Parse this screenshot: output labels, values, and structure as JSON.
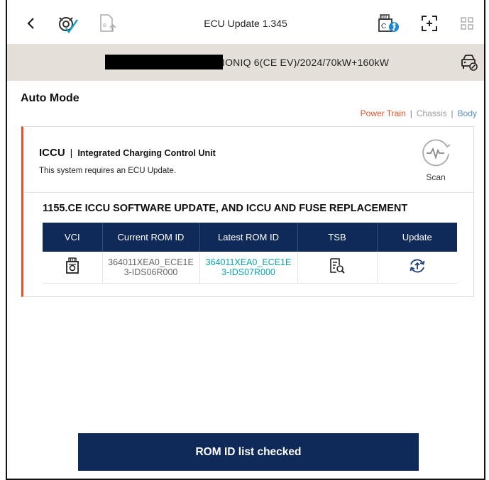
{
  "app": {
    "title": "ECU Update 1.345"
  },
  "vehicle": {
    "description": "IONIQ 6(CE EV)/2024/70kW+160kW"
  },
  "mode": {
    "title": "Auto Mode"
  },
  "categories": [
    {
      "label": "Power Train",
      "color": "#e2502d",
      "active": true
    },
    {
      "label": "Chassis",
      "color": "#9a9a9a",
      "active": false
    },
    {
      "label": "Body",
      "color": "#5a93c8",
      "active": false
    }
  ],
  "system": {
    "code": "ICCU",
    "divider": "|",
    "name": "Integrated Charging Control Unit",
    "message": "This system requires an ECU Update.",
    "scan_label": "Scan"
  },
  "update": {
    "title": "1155.CE ICCU SOFTWARE UPDATE, AND ICCU AND FUSE REPLACEMENT",
    "columns": [
      "VCI",
      "Current ROM ID",
      "Latest ROM ID",
      "TSB",
      "Update"
    ],
    "row": {
      "current_rom_line1": "364011XEA0_ECE1E",
      "current_rom_line2": "3-IDS06R000",
      "latest_rom_line1": "364011XEA0_ECE1E",
      "latest_rom_line2": "3-IDS07R000"
    }
  },
  "actions": {
    "primary_label": "ROM ID list checked"
  },
  "colors": {
    "accent_navy": "#0f2a58",
    "alert_red": "#e2502d",
    "teal": "#0aa3b3",
    "vehicle_bar": "#e4dfd9"
  },
  "icons": [
    "back-arrow-icon",
    "vci-check-icon",
    "export-doc-icon",
    "bluetooth-vci-icon",
    "screenshot-icon",
    "grid-menu-icon",
    "vehicle-info-icon",
    "scan-waveform-icon",
    "vci-device-icon",
    "tsb-document-search-icon",
    "update-refresh-icon"
  ]
}
